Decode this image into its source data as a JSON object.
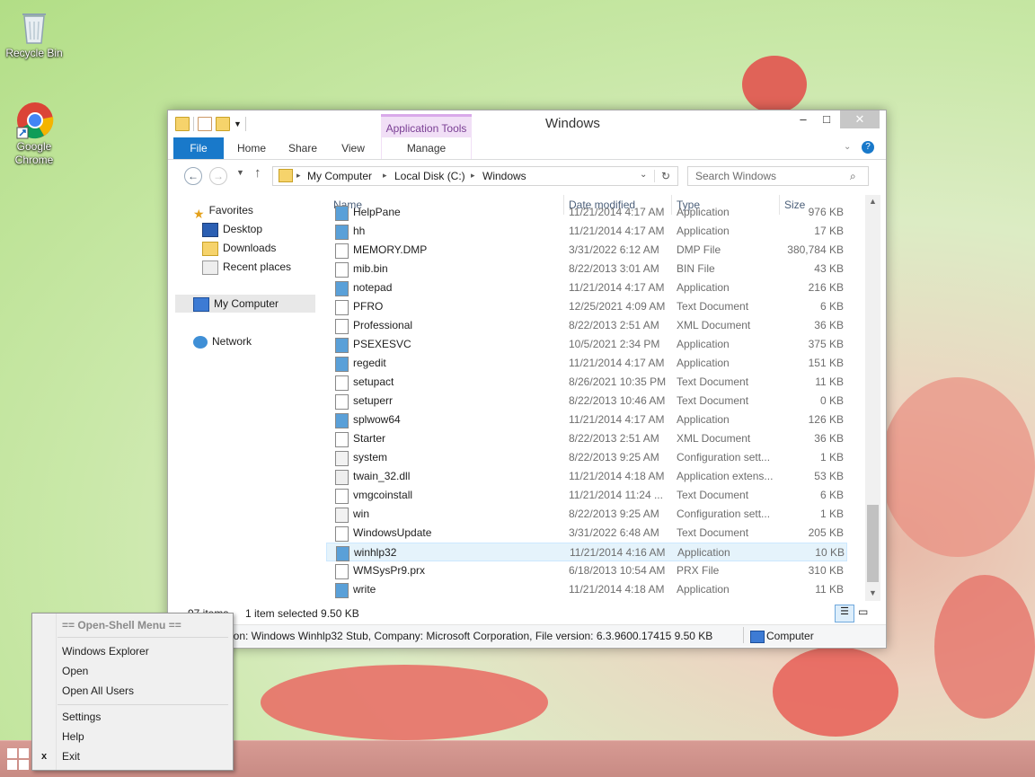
{
  "desktop": {
    "icons": [
      {
        "label": "Recycle Bin",
        "icon": "recycle-bin-icon"
      },
      {
        "label": "Google Chrome",
        "icon": "chrome-icon"
      }
    ]
  },
  "window": {
    "title": "Windows",
    "context_tab_group": "Application Tools",
    "ribbon_tabs": [
      "File",
      "Home",
      "Share",
      "View",
      "Manage"
    ],
    "address": {
      "segments": [
        "My Computer",
        "Local Disk (C:)",
        "Windows"
      ]
    },
    "search_placeholder": "Search Windows",
    "nav": {
      "favorites": "Favorites",
      "favorites_items": [
        "Desktop",
        "Downloads",
        "Recent places"
      ],
      "computer": "My Computer",
      "network": "Network"
    },
    "columns": {
      "name": "Name",
      "date": "Date modified",
      "type": "Type",
      "size": "Size"
    },
    "partial_row": {
      "name": "HelpPane",
      "date": "11/21/2014 4:17 AM",
      "type": "Application",
      "size": "976 KB"
    },
    "files": [
      {
        "name": "hh",
        "date": "11/21/2014 4:17 AM",
        "type": "Application",
        "size": "17 KB"
      },
      {
        "name": "MEMORY.DMP",
        "date": "3/31/2022 6:12 AM",
        "type": "DMP File",
        "size": "380,784 KB"
      },
      {
        "name": "mib.bin",
        "date": "8/22/2013 3:01 AM",
        "type": "BIN File",
        "size": "43 KB"
      },
      {
        "name": "notepad",
        "date": "11/21/2014 4:17 AM",
        "type": "Application",
        "size": "216 KB"
      },
      {
        "name": "PFRO",
        "date": "12/25/2021 4:09 AM",
        "type": "Text Document",
        "size": "6 KB"
      },
      {
        "name": "Professional",
        "date": "8/22/2013 2:51 AM",
        "type": "XML Document",
        "size": "36 KB"
      },
      {
        "name": "PSEXESVC",
        "date": "10/5/2021 2:34 PM",
        "type": "Application",
        "size": "375 KB"
      },
      {
        "name": "regedit",
        "date": "11/21/2014 4:17 AM",
        "type": "Application",
        "size": "151 KB"
      },
      {
        "name": "setupact",
        "date": "8/26/2021 10:35 PM",
        "type": "Text Document",
        "size": "11 KB"
      },
      {
        "name": "setuperr",
        "date": "8/22/2013 10:46 AM",
        "type": "Text Document",
        "size": "0 KB"
      },
      {
        "name": "splwow64",
        "date": "11/21/2014 4:17 AM",
        "type": "Application",
        "size": "126 KB"
      },
      {
        "name": "Starter",
        "date": "8/22/2013 2:51 AM",
        "type": "XML Document",
        "size": "36 KB"
      },
      {
        "name": "system",
        "date": "8/22/2013 9:25 AM",
        "type": "Configuration sett...",
        "size": "1 KB"
      },
      {
        "name": "twain_32.dll",
        "date": "11/21/2014 4:18 AM",
        "type": "Application extens...",
        "size": "53 KB"
      },
      {
        "name": "vmgcoinstall",
        "date": "11/21/2014 11:24 ...",
        "type": "Text Document",
        "size": "6 KB"
      },
      {
        "name": "win",
        "date": "8/22/2013 9:25 AM",
        "type": "Configuration sett...",
        "size": "1 KB"
      },
      {
        "name": "WindowsUpdate",
        "date": "3/31/2022 6:48 AM",
        "type": "Text Document",
        "size": "205 KB"
      },
      {
        "name": "winhlp32",
        "date": "11/21/2014 4:16 AM",
        "type": "Application",
        "size": "10 KB",
        "selected": true
      },
      {
        "name": "WMSysPr9.prx",
        "date": "6/18/2013 10:54 AM",
        "type": "PRX File",
        "size": "310 KB"
      },
      {
        "name": "write",
        "date": "11/21/2014 4:18 AM",
        "type": "Application",
        "size": "11 KB"
      }
    ],
    "status": {
      "count": "97 items",
      "selection": "1 item selected  9.50 KB"
    },
    "details": {
      "description": "ion: Windows Winhlp32 Stub, Company: Microsoft Corporation, File version: 6.3.9600.17415 9.50 KB",
      "location": "Computer"
    }
  },
  "context_menu": {
    "header": "== Open-Shell Menu ==",
    "items": [
      "Windows Explorer",
      "Open",
      "Open All Users"
    ],
    "items2": [
      "Settings",
      "Help",
      "Exit"
    ],
    "exit_glyph": "x"
  },
  "colors": {
    "accent": "#1979ca",
    "selection": "#e5f3fb",
    "taskbar": "#d09088"
  }
}
